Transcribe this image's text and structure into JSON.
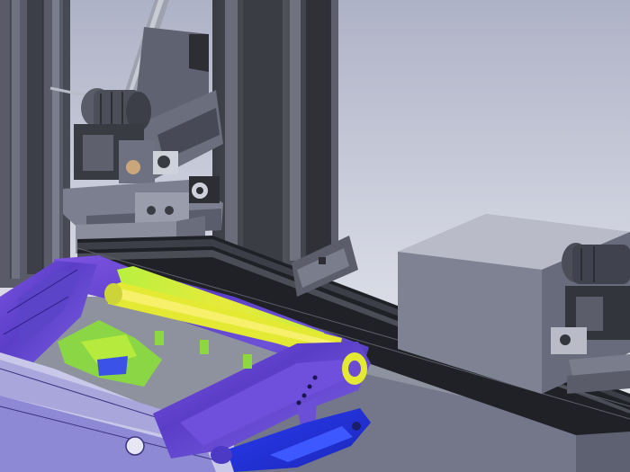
{
  "viewport": {
    "kind": "3D CAD model viewport",
    "palette": {
      "background_top": "#aeb2c6",
      "background_bottom": "#e6e8ee",
      "metal_dark": "#2e3036",
      "metal_mid": "#5b5e6c",
      "metal_light": "#8e92a6",
      "rail": "#24262b",
      "stress_violet": "#6a4bd2",
      "stress_blue": "#2438e0",
      "stress_green": "#7fe04a",
      "stress_yellow": "#e8ea3a",
      "stress_cyan": "#2ad0c8"
    },
    "components": [
      {
        "id": "left-column",
        "icon": "aluminum-extrusion-icon"
      },
      {
        "id": "center-column",
        "icon": "aluminum-extrusion-icon"
      },
      {
        "id": "upper-actuator",
        "icon": "servo-motor-icon"
      },
      {
        "id": "lower-rail",
        "icon": "linear-rail-icon"
      },
      {
        "id": "right-block",
        "icon": "housing-block-icon"
      },
      {
        "id": "right-actuator",
        "icon": "servo-motor-icon"
      },
      {
        "id": "table-surface",
        "icon": "plate-icon"
      },
      {
        "id": "frame-part",
        "icon": "analysis-part-icon"
      }
    ]
  }
}
